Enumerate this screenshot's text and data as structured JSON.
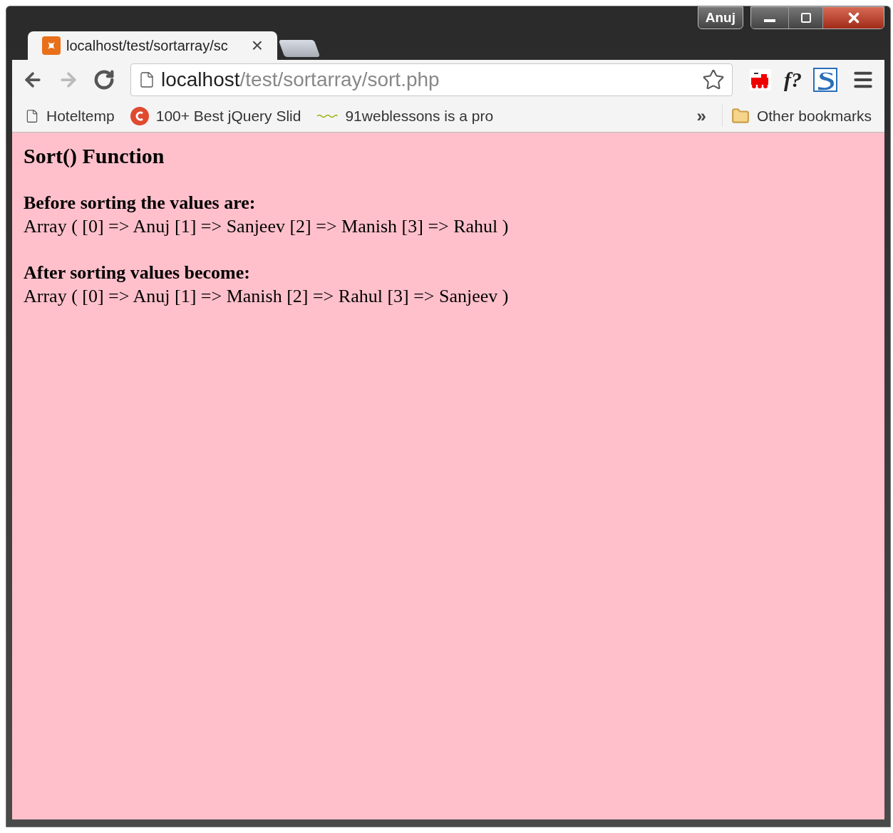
{
  "profile": {
    "name": "Anuj"
  },
  "tabs": [
    {
      "title": "localhost/test/sortarray/sc",
      "close": "×",
      "selected": true
    }
  ],
  "address_bar": {
    "host": "localhost",
    "path": "/test/sortarray/sort.php"
  },
  "extensions": [
    {
      "kind": "train"
    },
    {
      "kind": "text",
      "label": "f?"
    },
    {
      "kind": "s"
    }
  ],
  "bookmarks": [
    {
      "kind": "page",
      "label": "Hoteltemp"
    },
    {
      "kind": "c",
      "label": "100+ Best jQuery Slid"
    },
    {
      "kind": "squiggle",
      "label": "91weblessons is a pro"
    }
  ],
  "bookmarks_more": "»",
  "other_bookmarks": "Other bookmarks",
  "page": {
    "title": "Sort() Function",
    "sections": [
      {
        "heading": "Before sorting the values are:",
        "text": "Array ( [0] => Anuj [1] => Sanjeev [2] => Manish [3] => Rahul )"
      },
      {
        "heading": "After sorting values become:",
        "text": "Array ( [0] => Anuj [1] => Manish [2] => Rahul [3] => Sanjeev )"
      }
    ]
  }
}
